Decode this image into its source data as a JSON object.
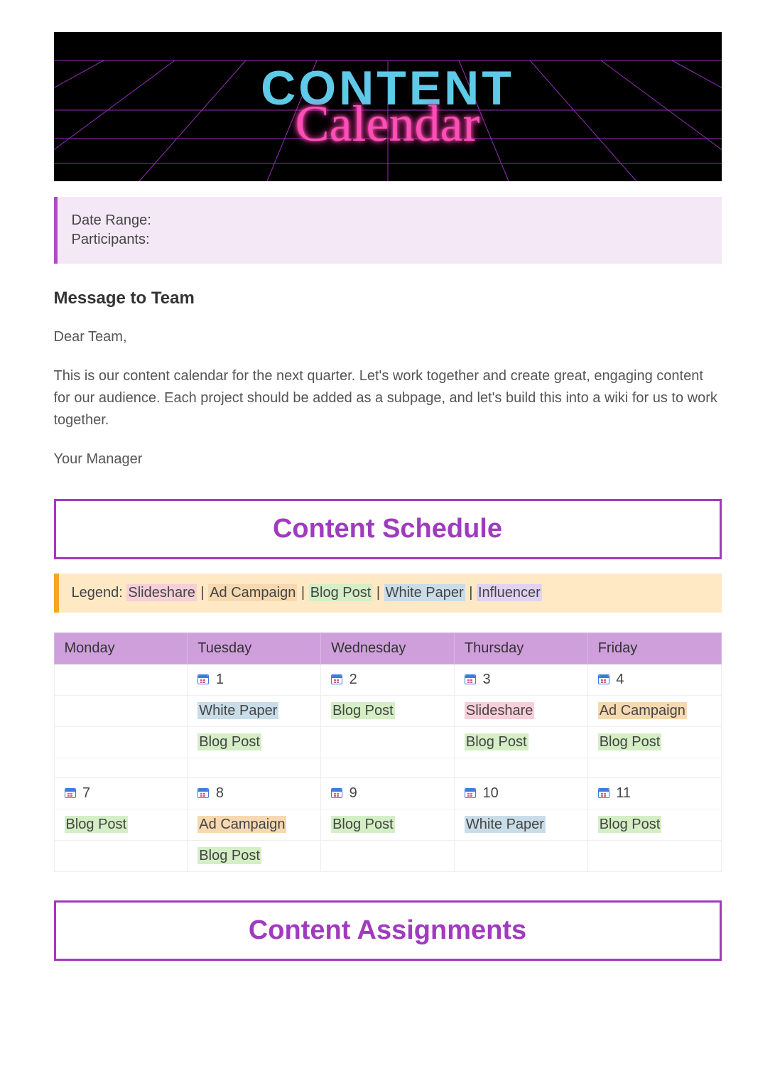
{
  "banner": {
    "line1": "CONTENT",
    "line2": "Calendar"
  },
  "meta": {
    "date_range_label": "Date Range:",
    "participants_label": "Participants:"
  },
  "message": {
    "heading": "Message to Team",
    "greeting": "Dear Team,",
    "body": "This is our content calendar for the next quarter. Let's work together and create great, engaging content for our audience. Each project should be added as a subpage, and let's build this into a wiki for us to work together.",
    "signoff": "Your Manager"
  },
  "schedule_header": "Content Schedule",
  "legend": {
    "label": "Legend:",
    "sep": " | ",
    "items": [
      "Slideshare",
      "Ad Campaign",
      "Blog Post",
      "White Paper",
      "Influencer"
    ]
  },
  "days": [
    "Monday",
    "Tuesday",
    "Wednesday",
    "Thursday",
    "Friday"
  ],
  "week1": {
    "dates": [
      "",
      "1",
      "2",
      "3",
      "4"
    ],
    "row1": [
      null,
      {
        "text": "White Paper",
        "type": "whitepaper"
      },
      {
        "text": "Blog Post",
        "type": "blogpost"
      },
      {
        "text": "Slideshare",
        "type": "slideshare"
      },
      {
        "text": "Ad Campaign",
        "type": "adcampaign"
      }
    ],
    "row2": [
      null,
      {
        "text": "Blog Post",
        "type": "blogpost"
      },
      null,
      {
        "text": "Blog Post",
        "type": "blogpost"
      },
      {
        "text": "Blog Post",
        "type": "blogpost"
      }
    ]
  },
  "week2": {
    "dates": [
      "7",
      "8",
      "9",
      "10",
      "11"
    ],
    "row1": [
      {
        "text": "Blog Post",
        "type": "blogpost"
      },
      {
        "text": "Ad Campaign",
        "type": "adcampaign"
      },
      {
        "text": "Blog Post",
        "type": "blogpost"
      },
      {
        "text": "White Paper",
        "type": "whitepaper"
      },
      {
        "text": "Blog Post",
        "type": "blogpost"
      }
    ],
    "row2": [
      null,
      {
        "text": "Blog Post",
        "type": "blogpost"
      },
      null,
      null,
      null
    ]
  },
  "assignments_header": "Content Assignments"
}
